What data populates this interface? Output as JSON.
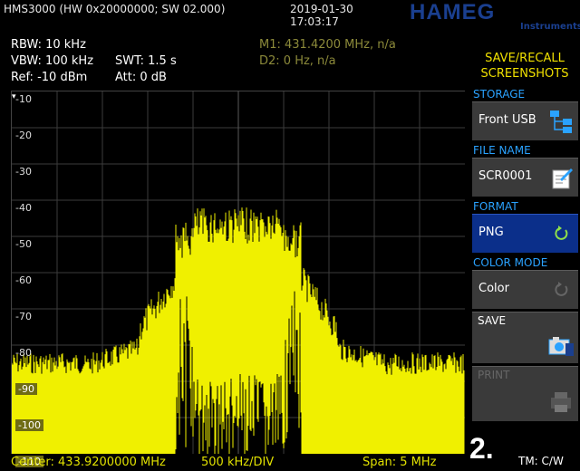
{
  "header": {
    "device": "HMS3000 (HW 0x20000000; SW 02.000)",
    "date": "2019-01-30",
    "time": "17:03:17",
    "logo": "HAMEG",
    "logo_sub": "Instruments"
  },
  "settings": {
    "rbw": "RBW: 10 kHz",
    "vbw": "VBW: 100 kHz",
    "swt": "SWT: 1.5 s",
    "ref": "Ref: -10 dBm",
    "att": "Att: 0 dB"
  },
  "markers": {
    "m1": "M1: 431.4200 MHz, n/a",
    "d2": "D2: 0 Hz, n/a"
  },
  "y_axis": [
    "-10",
    "-20",
    "-30",
    "-40",
    "-50",
    "-60",
    "-70",
    "-80",
    "-90",
    "-100",
    "-110"
  ],
  "bottom": {
    "center": "Center: 433.9200000 MHz",
    "div": "500 kHz/DIV",
    "span": "Span: 5 MHz"
  },
  "menu": {
    "title_line1": "SAVE/RECALL",
    "title_line2": "SCREENSHOTS",
    "storage_label": "STORAGE",
    "storage_value": "Front USB",
    "filename_label": "FILE NAME",
    "filename_value": "SCR0001",
    "format_label": "FORMAT",
    "format_value": "PNG",
    "colormode_label": "COLOR MODE",
    "colormode_value": "Color",
    "save_label": "SAVE",
    "print_label": "PRINT"
  },
  "status": {
    "number": "2.",
    "tm": "TM: C/W"
  },
  "colors": {
    "trace": "#f0f000",
    "accent": "#2aa2ff",
    "menu_title": "#f0e000",
    "selected": "#0b2f8a"
  }
}
